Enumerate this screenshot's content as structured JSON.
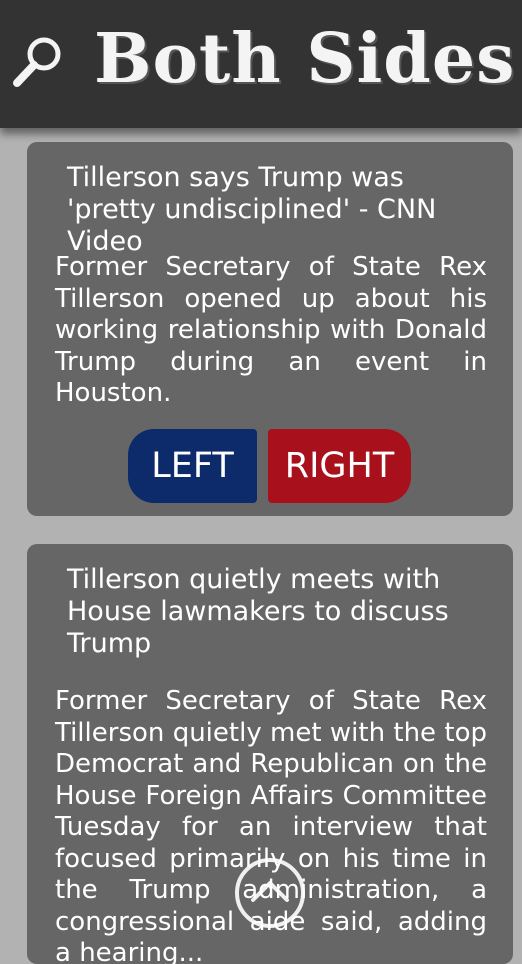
{
  "app": {
    "title": "Both Sides"
  },
  "header": {
    "search_icon": "search-icon"
  },
  "articles": [
    {
      "title": "Tillerson says Trump was 'pretty undisciplined' - CNN Video",
      "description": "Former Secretary of State Rex Tillerson opened up about his working relationship with Don­ald Trump during an event in Houston.",
      "left_label": "LEFT",
      "right_label": "RIGHT"
    },
    {
      "title": "Tillerson quietly meets with House lawmakers to discuss Trump",
      "description": "Former Secretary of State Rex Tillerson quietly met with the top Democrat and Republican on the House Foreign Affairs Committee Tuesday for an inter­view that focused primarily on his time in the Trump adminis­tration, a congressional aide said, adding a hearing..."
    }
  ],
  "colors": {
    "left": "#0d2a6a",
    "right": "#a8101c",
    "header": "#333333",
    "card": "#666666"
  },
  "floating": {
    "icon": "chevron-up-icon"
  }
}
